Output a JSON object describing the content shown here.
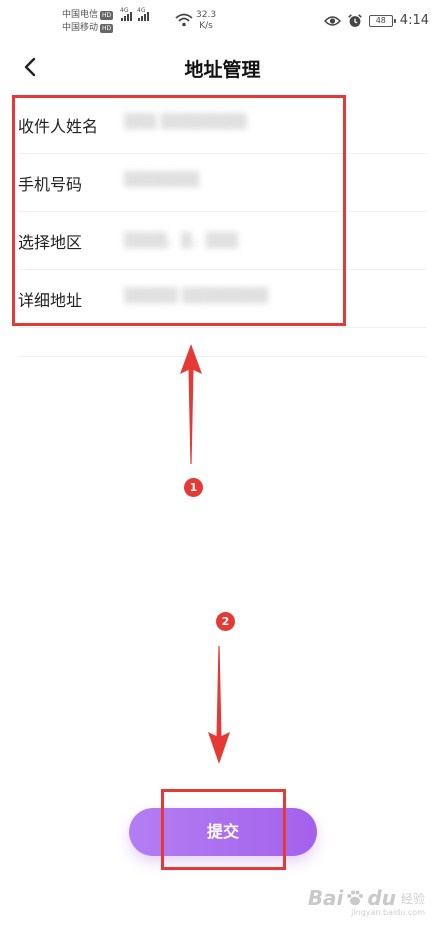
{
  "status_bar": {
    "carrier_1": "中国电信",
    "carrier_2": "中国移动",
    "hd_badge": "HD",
    "network_1": "4G",
    "network_2": "4G",
    "speed_value": "32.3",
    "speed_unit": "K/s",
    "battery": "48",
    "time": "4:14"
  },
  "header": {
    "title": "地址管理"
  },
  "form": {
    "rows": [
      {
        "label": "收件人姓名",
        "value": "▒▒▒ ▒▒▒▒▒▒▒▒"
      },
      {
        "label": "手机号码",
        "value": "▒▒▒▒▒▒▒"
      },
      {
        "label": "选择地区",
        "value": "▒▒▒▒，▒，▒▒▒"
      },
      {
        "label": "详细地址",
        "value": "▒▒▒▒▒ ▒▒▒▒▒▒▒▒"
      }
    ]
  },
  "annotations": {
    "step_1": "1",
    "step_2": "2",
    "highlight_color": "#e53935"
  },
  "submit": {
    "label": "提交",
    "color": "#a461ec"
  },
  "watermark": {
    "brand": "Bai",
    "brand_end": "du",
    "sub": "经验",
    "url": "jingyan.baidu.com"
  }
}
